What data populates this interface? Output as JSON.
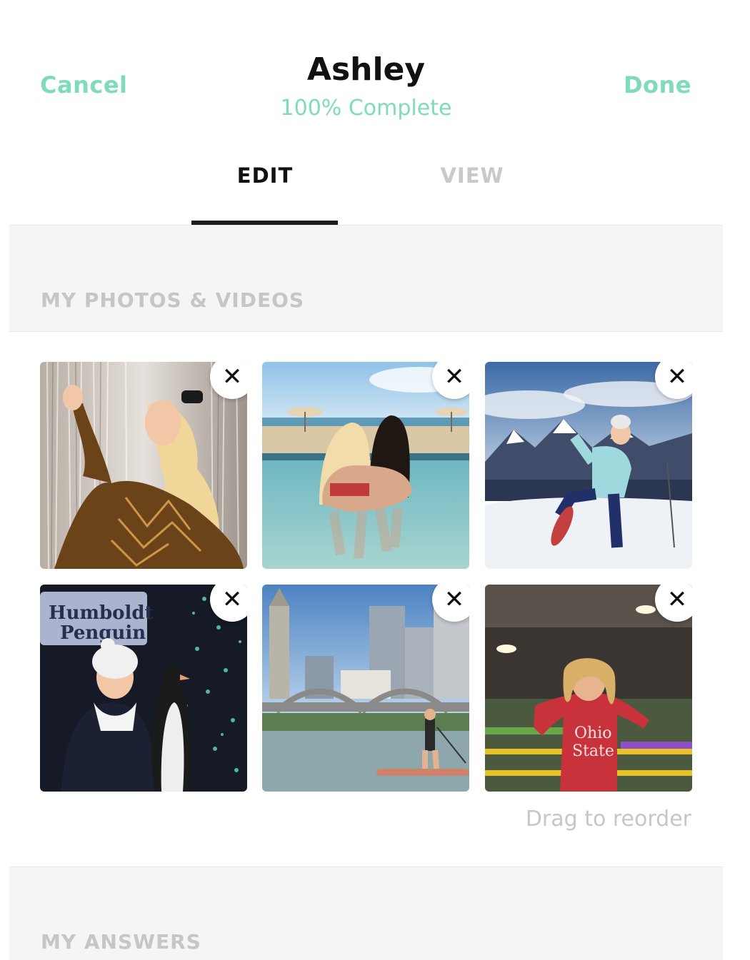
{
  "header": {
    "cancel_label": "Cancel",
    "done_label": "Done",
    "title": "Ashley",
    "subtitle": "100% Complete",
    "accent_color": "#7fdcb8"
  },
  "tabs": [
    {
      "label": "EDIT",
      "active": true
    },
    {
      "label": "VIEW",
      "active": false
    }
  ],
  "photos_section": {
    "title": "MY PHOTOS & VIDEOS",
    "photos": [
      {
        "description": "woman in gold sequin dress before silver tinsel curtain"
      },
      {
        "description": "two women in a pool facing the beach with umbrellas"
      },
      {
        "description": "woman snowshoeing in front of snowy mountains"
      },
      {
        "description": "woman in white hat beside a penguin statue",
        "sign_text": [
          "Humboldt",
          "Penguin"
        ]
      },
      {
        "description": "paddleboarder on a river below a city skyline and bridge"
      },
      {
        "description": "woman in red sweatshirt at an indoor trampoline park",
        "shirt_text": [
          "Ohio",
          "State"
        ]
      }
    ],
    "remove_icon": "close-icon",
    "drag_hint": "Drag to reorder"
  },
  "answers_section": {
    "title": "MY ANSWERS"
  }
}
